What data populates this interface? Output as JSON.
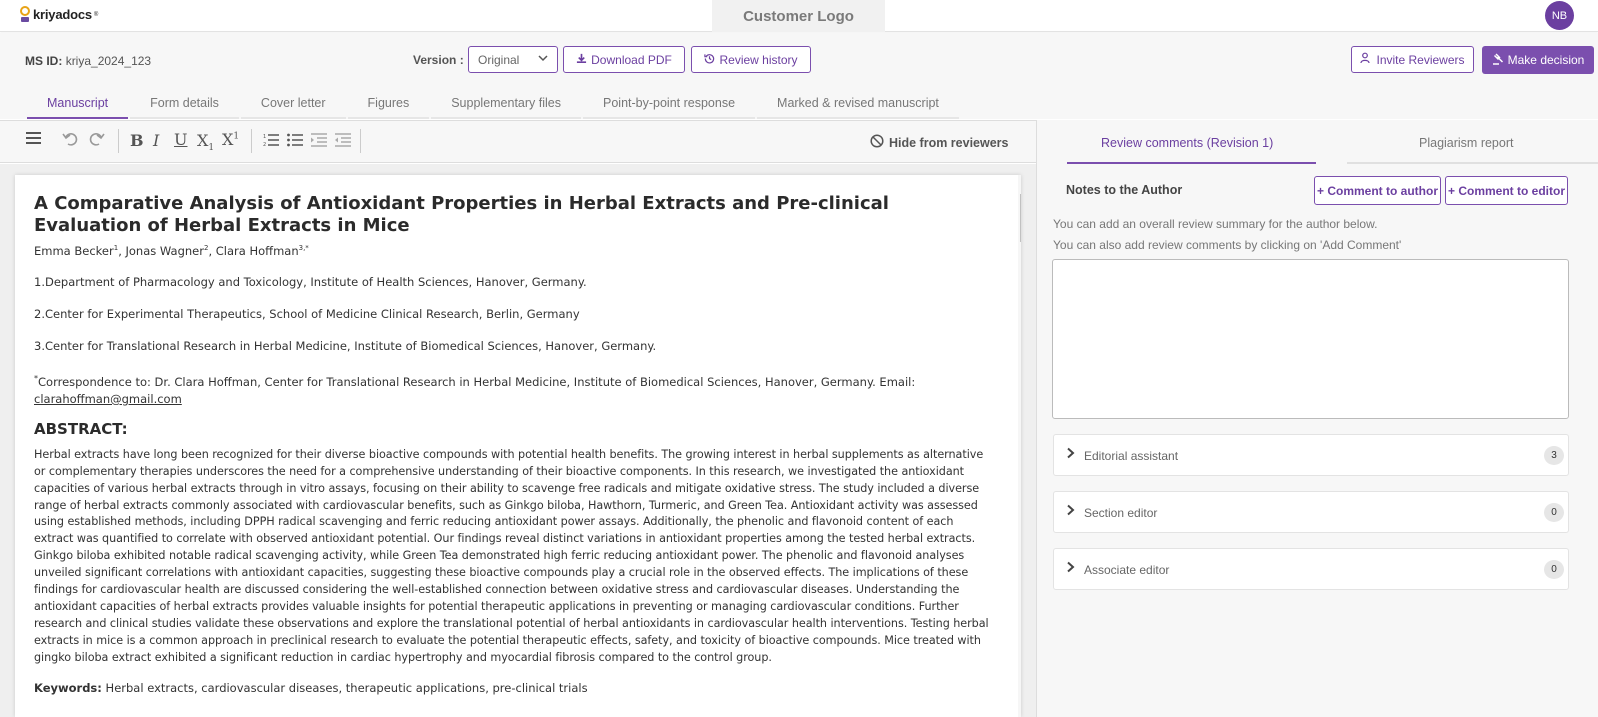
{
  "app": {
    "brand": "kriyadocs",
    "customer_logo": "Customer Logo",
    "user_initials": "NB"
  },
  "subheader": {
    "ms_id_label": "MS ID",
    "ms_id_value": "kriya_2024_123",
    "version_label": "Version :",
    "version_selected": "Original",
    "download_pdf": "Download PDF",
    "review_history": "Review history",
    "invite_reviewers": "Invite Reviewers",
    "make_decision": "Make decision"
  },
  "tabs": [
    {
      "label": "Manuscript",
      "active": true
    },
    {
      "label": "Form details"
    },
    {
      "label": "Cover letter"
    },
    {
      "label": "Figures"
    },
    {
      "label": "Supplementary files"
    },
    {
      "label": "Point-by-point response"
    },
    {
      "label": "Marked & revised manuscript"
    }
  ],
  "toolbar": {
    "hide_from_reviewers": "Hide from reviewers"
  },
  "document": {
    "title": "A Comparative Analysis of Antioxidant Properties in Herbal Extracts and Pre-clinical Evaluation of Herbal Extracts in Mice",
    "authors": [
      {
        "name": "Emma Becker",
        "sup": "1"
      },
      {
        "name": "Jonas Wagner",
        "sup": "2"
      },
      {
        "name": "Clara Hoffman",
        "sup": "3,*"
      }
    ],
    "affiliations": [
      "1.Department of Pharmacology and Toxicology, Institute of Health Sciences, Hanover, Germany.",
      "2.Center for Experimental Therapeutics, School of Medicine Clinical Research, Berlin, Germany",
      "3.Center for Translational Research in Herbal Medicine, Institute of Biomedical Sciences, Hanover, Germany."
    ],
    "correspondence": "Correspondence to: Dr. Clara Hoffman, Center for Translational Research in Herbal Medicine, Institute of Biomedical Sciences, Hanover, Germany. Email:",
    "correspondence_sup": "*",
    "email": "clarahoffman@gmail.com",
    "abstract_heading": "ABSTRACT:",
    "abstract": "Herbal extracts have long been recognized for their diverse bioactive compounds with potential health benefits. The growing interest in herbal supplements as alternative or complementary therapies underscores the need for a comprehensive understanding of their bioactive components. In this research, we investigated the antioxidant capacities of various herbal extracts through in vitro assays, focusing on their ability to scavenge free radicals and mitigate oxidative stress. The study included a diverse range of herbal extracts commonly associated with cardiovascular benefits, such as Ginkgo biloba, Hawthorn, Turmeric, and Green Tea. Antioxidant activity was assessed using established methods, including DPPH radical scavenging and ferric reducing antioxidant power assays. Additionally, the phenolic and flavonoid content of each extract was quantified to correlate with observed antioxidant potential. Our findings reveal distinct variations in antioxidant properties among the tested herbal extracts. Ginkgo biloba exhibited notable radical scavenging activity, while Green Tea demonstrated high ferric reducing antioxidant power. The phenolic and flavonoid analyses unveiled significant correlations with antioxidant capacities, suggesting these bioactive compounds play a crucial role in the observed effects. The implications of these findings for cardiovascular health are discussed considering the well-established connection between oxidative stress and cardiovascular diseases. Understanding the antioxidant capacities of herbal extracts provides valuable insights for potential therapeutic applications in preventing or managing cardiovascular conditions. Further research and clinical studies validate these observations and explore the translational potential of herbal antioxidants in cardiovascular health interventions. Testing herbal extracts in mice is a common approach in preclinical research to evaluate the potential therapeutic effects, safety, and toxicity of bioactive compounds. Mice treated with gingko biloba extract exhibited a significant reduction in cardiac hypertrophy and myocardial fibrosis compared to the control group.",
    "keywords_label": "Keywords:",
    "keywords": "Herbal extracts, cardiovascular diseases, therapeutic applications, pre-clinical trials"
  },
  "right_panel": {
    "tab_review": "Review comments (Revision 1)",
    "tab_plagiarism": "Plagiarism report",
    "notes_title": "Notes to the Author",
    "comment_author": "+ Comment to author",
    "comment_editor": "+ Comment to editor",
    "hint1": "You can add an overall review summary for the author below.",
    "hint2": "You can also add review comments by clicking on 'Add Comment'",
    "accordions": [
      {
        "label": "Editorial assistant",
        "count": "3"
      },
      {
        "label": "Section editor",
        "count": "0"
      },
      {
        "label": "Associate editor",
        "count": "0"
      }
    ]
  },
  "colors": {
    "accent": "#7b4fae",
    "avatar": "#6b3fa0",
    "logo_ring": "#e8a317"
  },
  "icons": [
    "menu-icon",
    "undo-icon",
    "redo-icon",
    "bold-icon",
    "italic-icon",
    "underline-icon",
    "subscript-icon",
    "superscript-icon",
    "ordered-list-icon",
    "bullet-list-icon",
    "outdent-icon",
    "indent-icon",
    "block-icon",
    "download-icon",
    "history-icon",
    "user-plus-icon",
    "gavel-icon",
    "chevron-right-icon",
    "chevron-down-icon"
  ]
}
